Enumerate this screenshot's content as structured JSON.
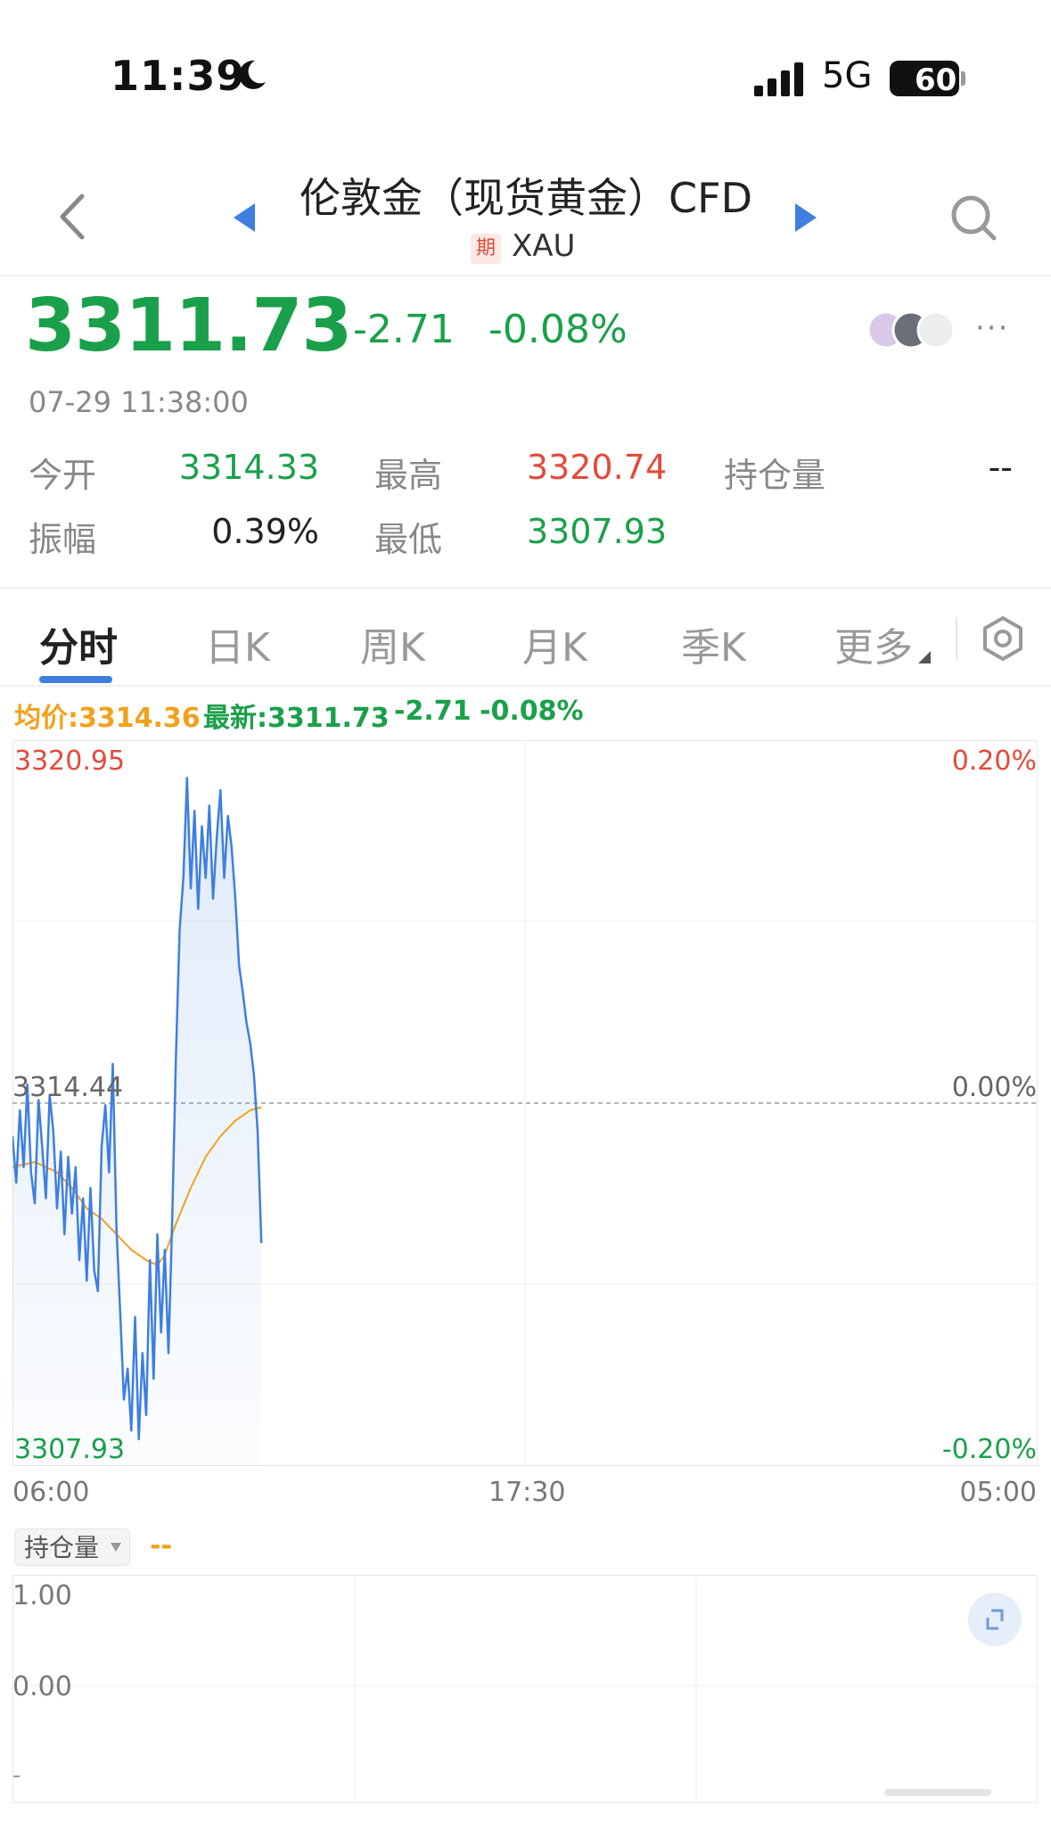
{
  "status_bar": {
    "time": "11:39",
    "network": "5G",
    "battery": "60",
    "icons": [
      "moon-icon",
      "signal-icon",
      "battery-icon"
    ]
  },
  "header": {
    "title": "伦敦金（现货黄金）CFD",
    "badge": "期",
    "symbol": "XAU",
    "icons": [
      "back-icon",
      "prev-arrow-icon",
      "next-arrow-icon",
      "search-icon"
    ]
  },
  "quote": {
    "price": "3311.73",
    "change": "-2.71",
    "change_pct": "-0.08%",
    "timestamp": "07-29 11:38:00",
    "more": "···"
  },
  "stats": {
    "open_label": "今开",
    "open_value": "3314.33",
    "high_label": "最高",
    "high_value": "3320.74",
    "oi_label": "持仓量",
    "oi_value": "--",
    "amplitude_label": "振幅",
    "amplitude_value": "0.39%",
    "low_label": "最低",
    "low_value": "3307.93"
  },
  "tabs": [
    {
      "label": "分时",
      "active": true
    },
    {
      "label": "日K"
    },
    {
      "label": "周K"
    },
    {
      "label": "月K"
    },
    {
      "label": "季K"
    },
    {
      "label": "更多"
    }
  ],
  "chart_info": {
    "avg": "均价:3314.36",
    "latest": "最新:3311.73",
    "change": "-2.71",
    "change_pct": "-0.08%"
  },
  "colors": {
    "up": "#e24b3b",
    "down": "#1aa04a",
    "price_line": "#3e7fe0",
    "avg_line": "#f0a21c",
    "accent": "#3e7fe0"
  },
  "chart_data": {
    "type": "line",
    "title": "",
    "xlabel": "",
    "ylabel": "",
    "ylim": [
      3307.93,
      3320.95
    ],
    "y_ticks": [
      "3320.95",
      "3314.44",
      "3307.93"
    ],
    "pct_ticks": [
      "0.20%",
      "0.00%",
      "-0.20%"
    ],
    "prev_close": 3314.44,
    "x_ticks": [
      "06:00",
      "17:30",
      "05:00"
    ],
    "session_minutes": 1380,
    "x_unit": "minutes from 06:00",
    "series": [
      {
        "values": [
          [
            0,
            3313.8
          ],
          [
            5,
            3312.9
          ],
          [
            10,
            3314.3
          ],
          [
            15,
            3313.2
          ],
          [
            20,
            3314.8
          ],
          [
            25,
            3313.1
          ],
          [
            30,
            3312.5
          ],
          [
            35,
            3314.5
          ],
          [
            40,
            3313.6
          ],
          [
            45,
            3312.6
          ],
          [
            50,
            3314.6
          ],
          [
            55,
            3313.9
          ],
          [
            60,
            3312.4
          ],
          [
            65,
            3313.5
          ],
          [
            70,
            3311.9
          ],
          [
            75,
            3313.4
          ],
          [
            80,
            3312.3
          ],
          [
            85,
            3313.2
          ],
          [
            90,
            3311.4
          ],
          [
            95,
            3312.6
          ],
          [
            100,
            3311.0
          ],
          [
            105,
            3312.8
          ],
          [
            110,
            3311.2
          ],
          [
            115,
            3310.8
          ],
          [
            120,
            3313.6
          ],
          [
            125,
            3314.4
          ],
          [
            130,
            3313.1
          ],
          [
            135,
            3315.2
          ],
          [
            140,
            3312.0
          ],
          [
            145,
            3310.4
          ],
          [
            150,
            3308.7
          ],
          [
            155,
            3309.3
          ],
          [
            160,
            3308.1
          ],
          [
            165,
            3310.3
          ],
          [
            170,
            3307.93
          ],
          [
            175,
            3309.6
          ],
          [
            180,
            3308.4
          ],
          [
            185,
            3311.4
          ],
          [
            190,
            3309.1
          ],
          [
            195,
            3311.9
          ],
          [
            200,
            3310.0
          ],
          [
            205,
            3311.6
          ],
          [
            210,
            3309.6
          ],
          [
            215,
            3312.2
          ],
          [
            220,
            3315.3
          ],
          [
            225,
            3317.8
          ],
          [
            230,
            3318.8
          ],
          [
            235,
            3320.74
          ],
          [
            240,
            3318.6
          ],
          [
            245,
            3320.1
          ],
          [
            250,
            3318.2
          ],
          [
            255,
            3319.8
          ],
          [
            260,
            3318.8
          ],
          [
            265,
            3320.2
          ],
          [
            270,
            3318.4
          ],
          [
            275,
            3319.6
          ],
          [
            280,
            3320.5
          ],
          [
            285,
            3318.8
          ],
          [
            290,
            3320.0
          ],
          [
            295,
            3319.4
          ],
          [
            300,
            3318.4
          ],
          [
            305,
            3317.1
          ],
          [
            310,
            3316.6
          ],
          [
            315,
            3316.0
          ],
          [
            320,
            3315.6
          ],
          [
            325,
            3315.0
          ],
          [
            330,
            3313.9
          ],
          [
            335,
            3311.73
          ]
        ]
      },
      {
        "values": [
          [
            0,
            3313.2
          ],
          [
            30,
            3313.3
          ],
          [
            60,
            3313.1
          ],
          [
            80,
            3312.8
          ],
          [
            100,
            3312.4
          ],
          [
            120,
            3312.2
          ],
          [
            140,
            3311.9
          ],
          [
            160,
            3311.6
          ],
          [
            180,
            3311.4
          ],
          [
            195,
            3311.3
          ],
          [
            205,
            3311.5
          ],
          [
            220,
            3312.1
          ],
          [
            240,
            3312.8
          ],
          [
            260,
            3313.4
          ],
          [
            280,
            3313.8
          ],
          [
            300,
            3314.1
          ],
          [
            320,
            3314.3
          ],
          [
            335,
            3314.36
          ]
        ]
      }
    ]
  },
  "open_interest": {
    "selector": "持仓量",
    "value": "--",
    "y_ticks": [
      "1.00",
      "0.00",
      "-"
    ]
  }
}
